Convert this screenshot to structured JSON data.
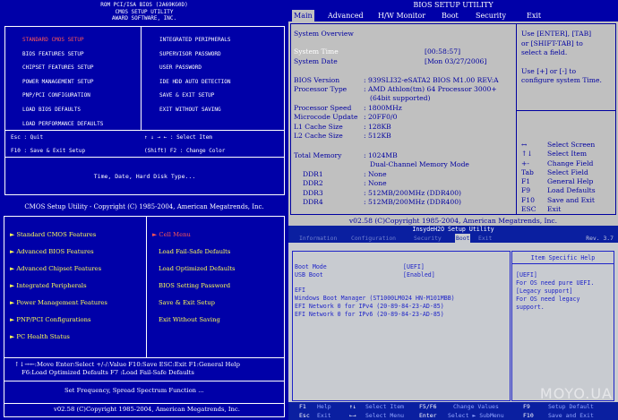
{
  "award": {
    "header": [
      "ROM PCI/ISA BIOS (2A69KG0D)",
      "CMOS SETUP UTILITY",
      "AWARD SOFTWARE, INC."
    ],
    "left_menu": [
      "STANDARD CMOS SETUP",
      "BIOS FEATURES SETUP",
      "CHIPSET FEATURES SETUP",
      "POWER MANAGEMENT SETUP",
      "PNP/PCI CONFIGURATION",
      "LOAD BIOS DEFAULTS",
      "LOAD PERFORMANCE DEFAULTS"
    ],
    "right_menu": [
      "INTEGRATED PERIPHERALS",
      "SUPERVISOR PASSWORD",
      "USER PASSWORD",
      "IDE HDD AUTO DETECTION",
      "SAVE & EXIT SETUP",
      "EXIT WITHOUT SAVING"
    ],
    "keys": {
      "esc": "Esc : Quit",
      "arrows": "↑ ↓ → ←  : Select Item",
      "f10": "F10 : Save & Exit Setup",
      "f2": "(Shift) F2 : Change Color"
    },
    "description": "Time, Date, Hard Disk Type..."
  },
  "aptio": {
    "title": "BIOS SETUP UTILITY",
    "tabs": [
      "Main",
      "Advanced",
      "H/W Monitor",
      "Boot",
      "Security",
      "Exit"
    ],
    "section": "System Overview",
    "system_time_label": "System Time",
    "system_time_value": "[00:58:57]",
    "system_date_label": "System Date",
    "system_date_value": "[Mon 03/27/2006]",
    "info": [
      {
        "label": "BIOS Version",
        "value": ": 939SLI32-eSATA2 BIOS M1.00 REV:A"
      },
      {
        "label": "Processor Type",
        "value": ": AMD Athlon(tm) 64 Processor 3000+"
      },
      {
        "label": "",
        "value": "(64bit supported)"
      },
      {
        "label": "Processor Speed",
        "value": ": 1800MHz"
      },
      {
        "label": "Microcode Update",
        "value": ": 20FF0/0"
      },
      {
        "label": "L1 Cache Size",
        "value": ": 128KB"
      },
      {
        "label": "L2 Cache Size",
        "value": ": 512KB"
      }
    ],
    "memory_label": "Total Memory",
    "memory_value": ": 1024MB",
    "memory_mode": "Dual-Channel Memory Mode",
    "ddr": [
      {
        "label": "DDR1",
        "value": ": None"
      },
      {
        "label": "DDR2",
        "value": ": None"
      },
      {
        "label": "DDR3",
        "value": ": 512MB/200MHz (DDR400)"
      },
      {
        "label": "DDR4",
        "value": ": 512MB/200MHz (DDR400)"
      }
    ],
    "help_lines": [
      "Use [ENTER], [TAB]",
      "or [SHIFT-TAB] to",
      "select a field.",
      "",
      "Use [+] or [-] to",
      "configure system Time."
    ],
    "key_help": [
      {
        "key": "↔",
        "desc": "Select Screen"
      },
      {
        "key": "↑↓",
        "desc": "Select Item"
      },
      {
        "key": "+-",
        "desc": "Change Field"
      },
      {
        "key": "Tab",
        "desc": "Select Field"
      },
      {
        "key": "F1",
        "desc": "General Help"
      },
      {
        "key": "F9",
        "desc": "Load Defaults"
      },
      {
        "key": "F10",
        "desc": "Save and Exit"
      },
      {
        "key": "ESC",
        "desc": "Exit"
      }
    ],
    "footer": "v02.58 (C)Copyright 1985-2004, American Megatrends, Inc."
  },
  "ami": {
    "title": "CMOS Setup Utility - Copyright (C) 1985-2004, American Megatrends, Inc.",
    "left_menu": [
      "Standard CMOS Features",
      "Advanced BIOS Features",
      "Advanced Chipset Features",
      "Integrated Peripherals",
      "Power Management Features",
      "PNP/PCI Configurations",
      "PC Health Status"
    ],
    "right_menu": [
      "Cell Menu",
      "Load Fail-Safe Defaults",
      "Load Optimized Defaults",
      "BIOS Setting Password",
      "Save & Exit Setup",
      "Exit Without Saving"
    ],
    "keys_line1": "↑↓→←:Move  Enter:Select  +/-/:Value  F10:Save  ESC:Exit  F1:General Help",
    "keys_line2": "F6:Load Optimized Defaults         F7 :Load Fail-Safe Defaults",
    "description": "Set Frequency, Spread Spectrum Function ...",
    "footer": "v02.58 (C)Copyright 1985-2004, American Megatrends, Inc."
  },
  "insyde": {
    "title": "InsydeH2O Setup Utility",
    "rev": "Rev. 3.7",
    "tabs": [
      "Information",
      "Configuration",
      "Security",
      "Boot",
      "Exit"
    ],
    "boot_mode_label": "Boot Mode",
    "boot_mode_value": "[UEFI]",
    "usb_boot_label": "USB Boot",
    "usb_boot_value": "[Enabled]",
    "efi_header": "EFI",
    "efi_items": [
      "Windows Boot Manager (ST1000LM024 HN-M101MBB)",
      "EFI Network 0 for IPv4 (20-89-84-23-AD-85)",
      "EFI Network 0 for IPv6 (20-89-84-23-AD-85)"
    ],
    "help_title": "Item Specific Help",
    "help_lines": [
      "[UEFI]",
      "For OS need pure UEFI.",
      "[Legacy support]",
      "For OS need legacy",
      "support."
    ],
    "bar": [
      {
        "key": "F1",
        "desc": "Help"
      },
      {
        "key": "↑↓",
        "desc": "Select Item"
      },
      {
        "key": "F5/F6",
        "desc": "Change Values"
      },
      {
        "key": "F9",
        "desc": "Setup Default"
      },
      {
        "key": "Esc",
        "desc": "Exit"
      },
      {
        "key": "←→",
        "desc": "Select Menu"
      },
      {
        "key": "Enter",
        "desc": "Select ► SubMenu"
      },
      {
        "key": "F10",
        "desc": "Save and Exit"
      }
    ],
    "watermark": "MOYO.UA"
  }
}
